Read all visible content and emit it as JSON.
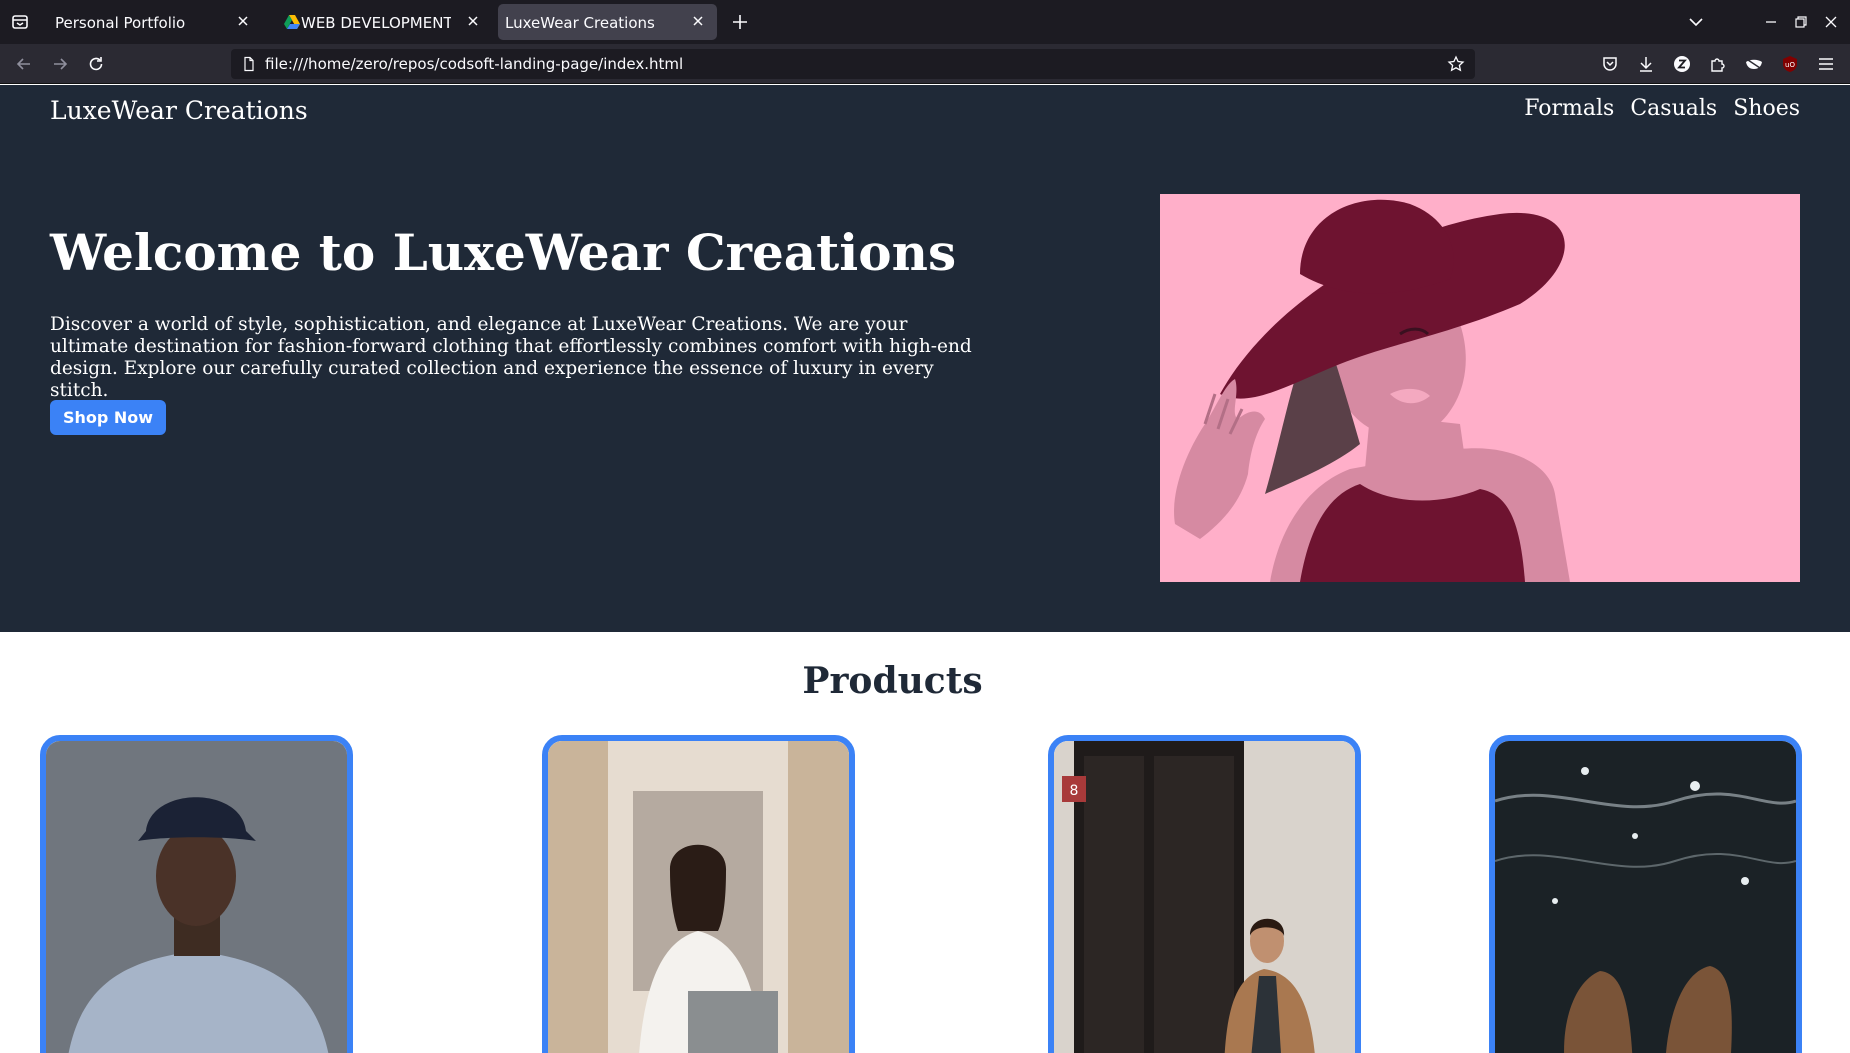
{
  "browser": {
    "tabs": [
      {
        "title": "Personal Portfolio"
      },
      {
        "title": "WEB DEVELOPMENT PRO"
      },
      {
        "title": "LuxeWear Creations"
      }
    ],
    "url": "file:///home/zero/repos/codsoft-landing-page/index.html"
  },
  "site": {
    "logo": "LuxeWear Creations",
    "nav": [
      "Formals",
      "Casuals",
      "Shoes"
    ],
    "hero": {
      "title": "Welcome to LuxeWear Creations",
      "text": "Discover a world of style, sophistication, and elegance at LuxeWear Creations. We are your ultimate destination for fashion-forward clothing that effortlessly combines comfort with high-end design. Explore our carefully curated collection and experience the essence of luxury in every stitch.",
      "button": "Shop Now"
    },
    "products_heading": "Products"
  },
  "colors": {
    "hero_bg": "#1f2937",
    "accent": "#3b82f6",
    "art_bg": "#ffafc9",
    "art_maroon": "#6e1330"
  }
}
